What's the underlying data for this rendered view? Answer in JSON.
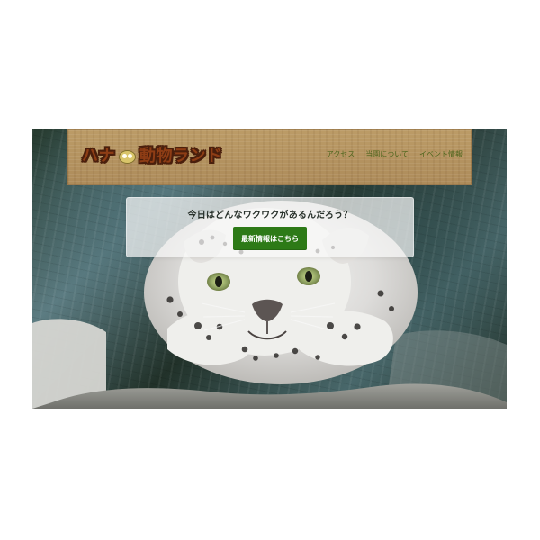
{
  "site": {
    "logo": {
      "left_text": "ハナ",
      "right_text": "動物ランド",
      "emblem_icon": "panda-face-icon"
    },
    "nav": {
      "items": [
        {
          "label": "アクセス"
        },
        {
          "label": "当園について"
        },
        {
          "label": "イベント情報"
        }
      ]
    },
    "hero": {
      "headline": "今日はどんなワクワクがあるんだろう？",
      "button_label": "最新情報はこちら",
      "image_subject": "snow-leopard-icon"
    },
    "colors": {
      "header_bg": "#b39562",
      "nav_text": "#4d651c",
      "logo_fill": "#8e3d15",
      "logo_outline": "#4a1f0c",
      "button_bg": "#2d7a17",
      "button_text": "#ffffff",
      "card_bg": "rgba(248,248,248,0.72)"
    }
  }
}
